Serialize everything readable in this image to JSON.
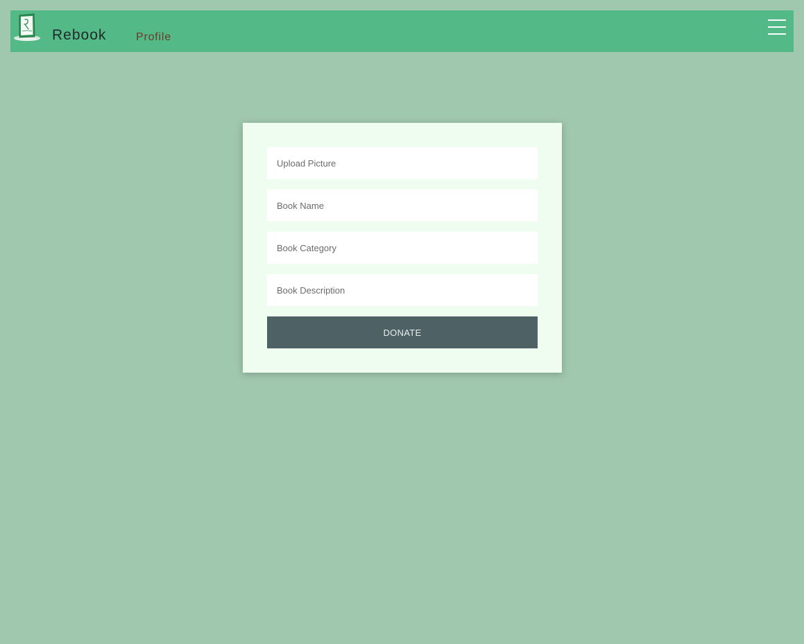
{
  "navbar": {
    "brand": "Rebook",
    "links": [
      {
        "label": "Profile"
      }
    ],
    "menu_icon": "hamburger-menu-icon",
    "logo_icon": "rebook-logo-icon",
    "background_color": "#53b987"
  },
  "form": {
    "fields": [
      {
        "placeholder": "Upload Picture",
        "value": ""
      },
      {
        "placeholder": "Book Name",
        "value": ""
      },
      {
        "placeholder": "Book Category",
        "value": ""
      },
      {
        "placeholder": "Book Description",
        "value": ""
      }
    ],
    "submit_label": "DONATE",
    "submit_color": "#4e6165",
    "card_color": "#eefdf0"
  },
  "page": {
    "background_color": "#a0c8ae"
  }
}
